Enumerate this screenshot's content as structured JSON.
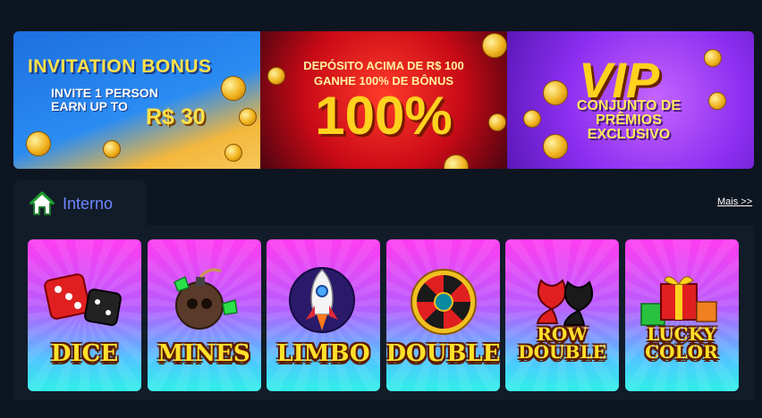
{
  "banners": [
    {
      "line1": "INVITATION BONUS",
      "line2a": "INVITE 1 PERSON",
      "line2b": "EARN UP TO",
      "line3": "R$ 30"
    },
    {
      "line1a": "DEPÓSITO ACIMA DE R$ 100",
      "line1b": "GANHE 100% DE BÔNUS",
      "line2": "100%"
    },
    {
      "line1": "VIP",
      "line2a": "CONJUNTO DE",
      "line2b": "PRÊMIOS",
      "line2c": "EXCLUSIVO"
    }
  ],
  "section": {
    "tab_label": "Interno",
    "more_label": "Mais >>",
    "tab_icon": "home-icon"
  },
  "games": [
    {
      "name": "DICE"
    },
    {
      "name": "MINES"
    },
    {
      "name": "LIMBO"
    },
    {
      "name": "DOUBLE"
    },
    {
      "name_line1": "ROW",
      "name_line2": "DOUBLE"
    },
    {
      "name_line1": "LUCKY",
      "name_line2": "COLOR"
    }
  ],
  "colors": {
    "background": "#0d1520",
    "panel": "#121c28",
    "tab_label": "#6f86ff",
    "title_yellow": "#ffd21e"
  }
}
